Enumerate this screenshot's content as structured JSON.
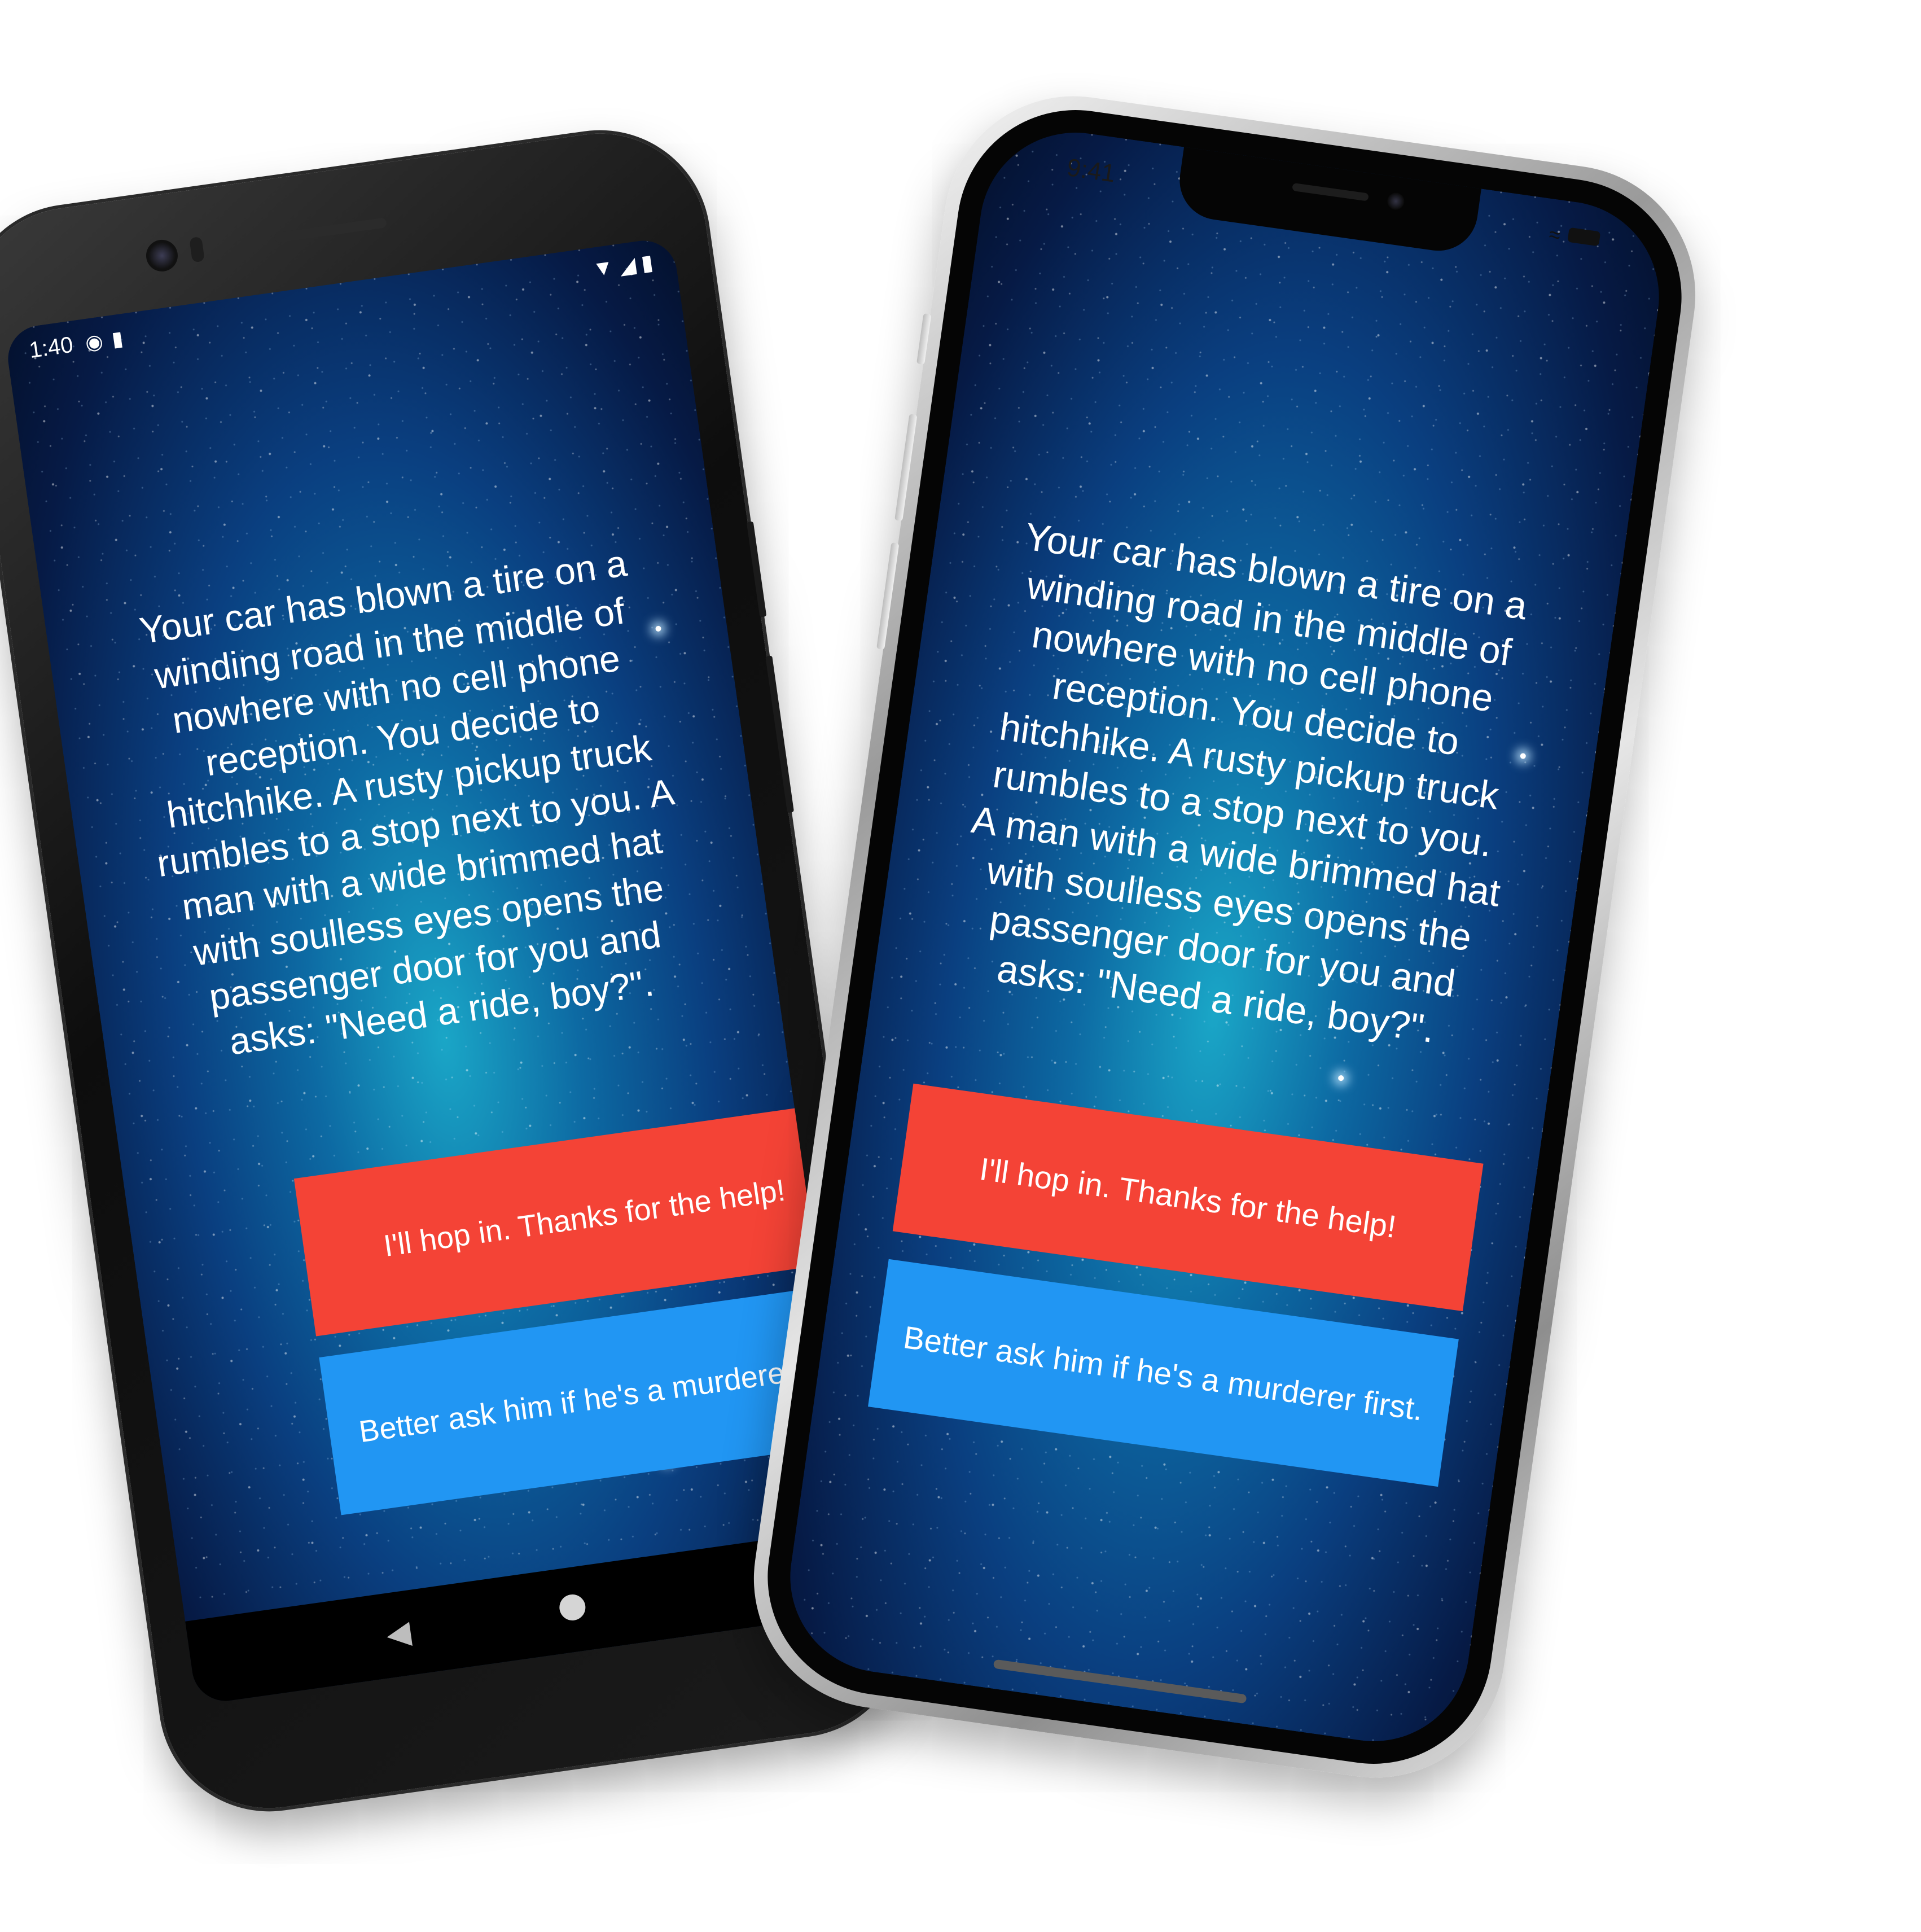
{
  "android": {
    "status_time": "1:40",
    "status_icons_left": [
      "app-notification-icon",
      "sd-card-icon"
    ],
    "status_icons_right": [
      "wifi-icon",
      "signal-icon",
      "battery-icon"
    ],
    "nav_icons": [
      "back-icon",
      "home-icon"
    ]
  },
  "iphone": {
    "status_time": "9:41",
    "status_icons_right": [
      "wifi-icon",
      "battery-icon"
    ]
  },
  "game": {
    "story_text": "Your car has blown a tire on a winding road in the middle of nowhere with no cell phone reception. You decide to hitchhike. A rusty pickup truck rumbles to a stop next to you. A man with a wide brimmed hat with soulless eyes opens the passenger door for you and asks: \"Need a ride, boy?\".",
    "choice_1": "I'll hop in. Thanks for the help!",
    "choice_2": "Better ask him if he's a murderer first."
  },
  "colors": {
    "choice_1_bg": "#f44336",
    "choice_2_bg": "#2196f3",
    "text": "#ffffff",
    "background_core": "#1aa6c7",
    "background_edge": "#04112e"
  }
}
